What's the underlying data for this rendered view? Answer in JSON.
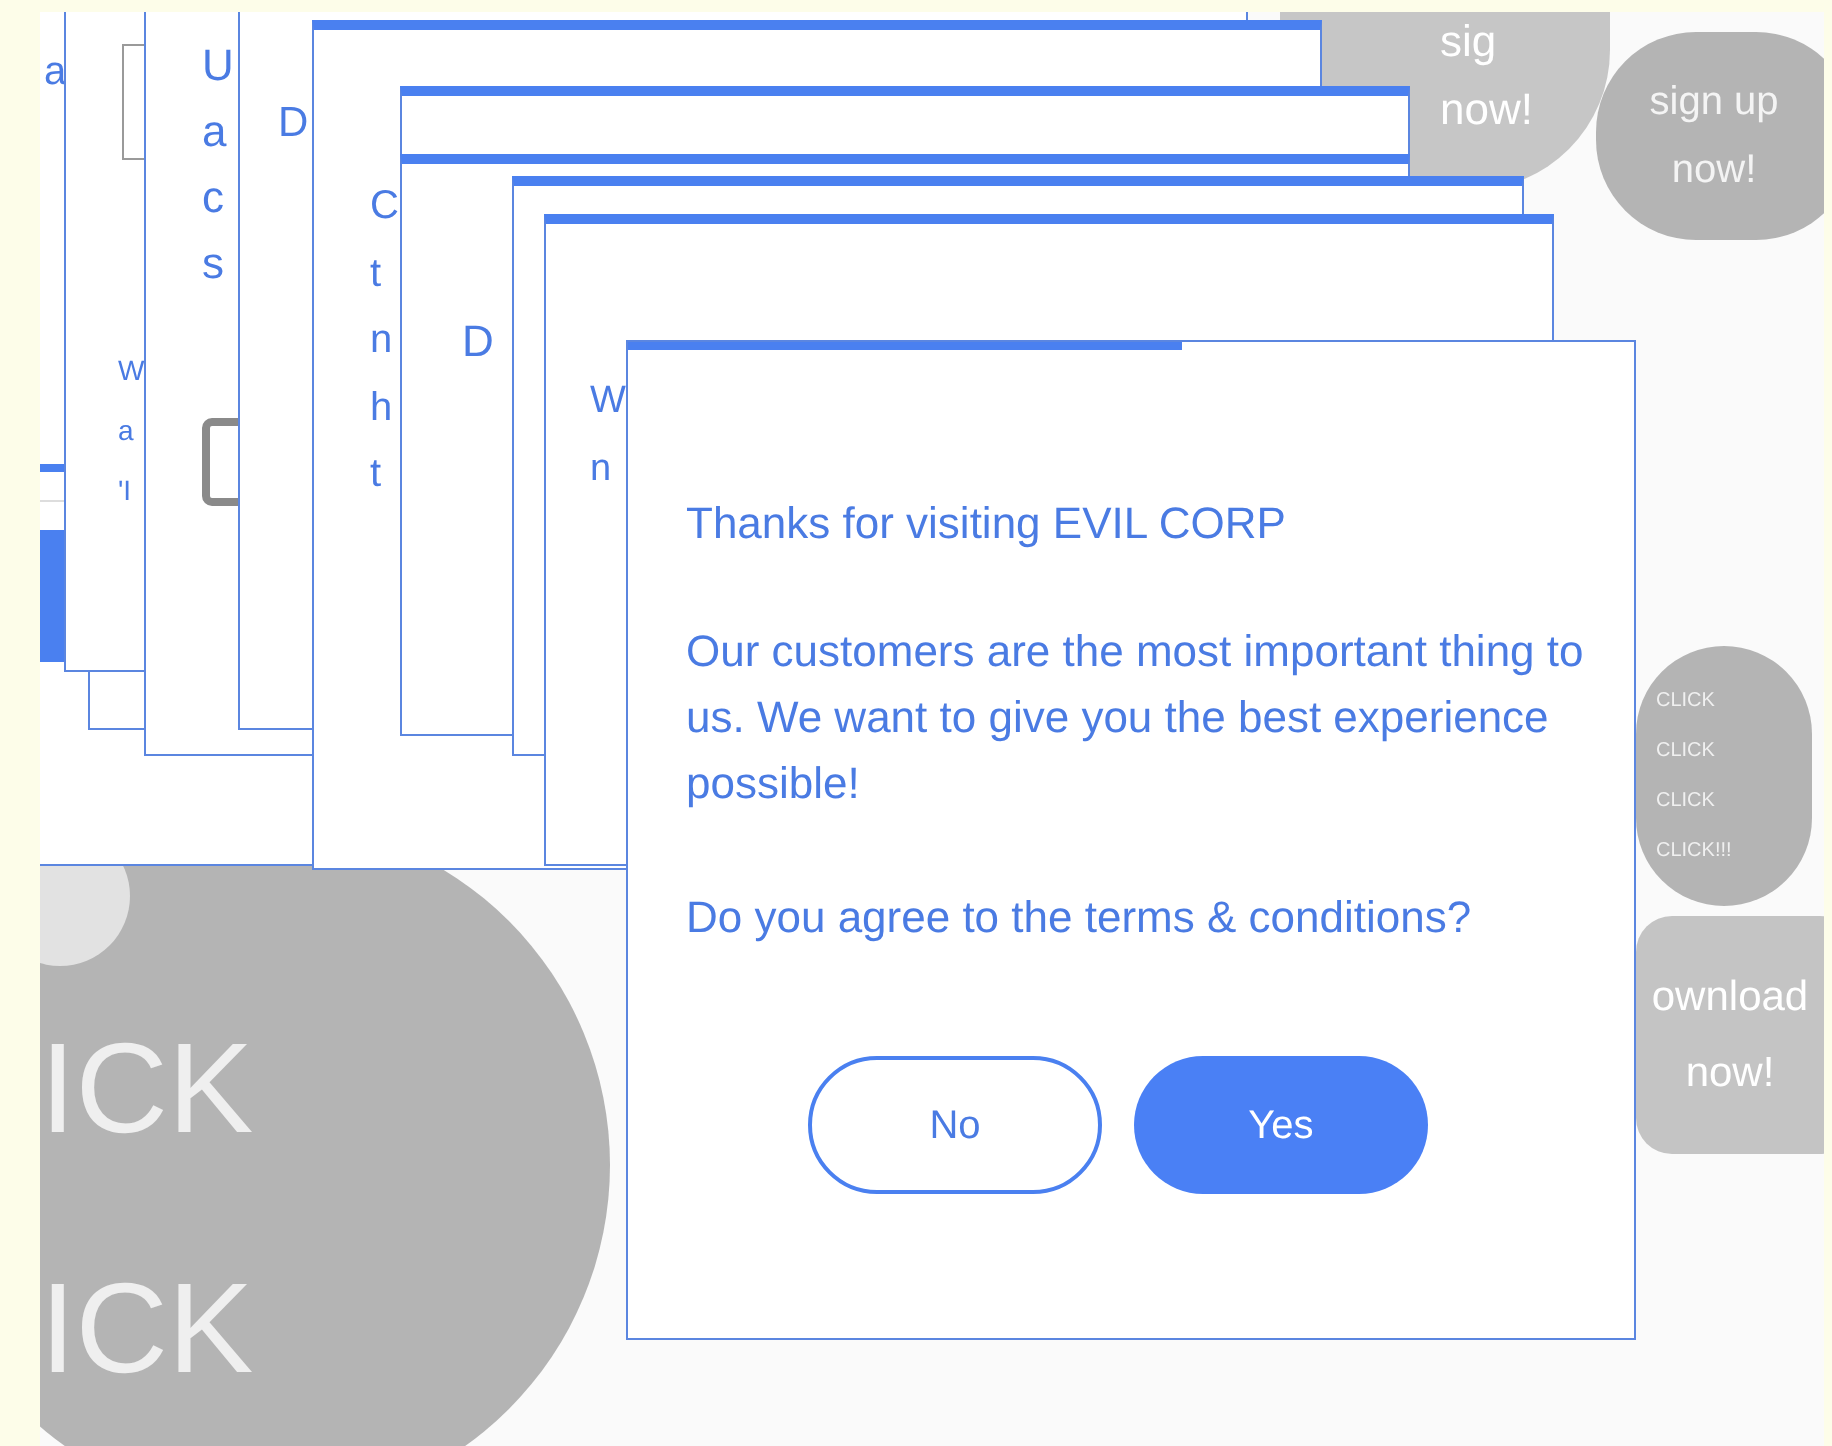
{
  "ads": [
    {
      "kind": "big_circle",
      "lines": [
        "ICK",
        "ICK"
      ]
    },
    {
      "kind": "small_circle"
    },
    {
      "kind": "top_blob",
      "lines": [
        "sig",
        "now!"
      ]
    },
    {
      "kind": "signup_pill",
      "lines": [
        "sign up",
        "now!"
      ]
    },
    {
      "kind": "click_circle",
      "lines": [
        "CLICK",
        "CLICK",
        "CLICK",
        "CLICK!!!"
      ]
    },
    {
      "kind": "download_box",
      "lines": [
        "ownload",
        "now!"
      ]
    }
  ],
  "background_dialogs": [
    {
      "kind": "button",
      "lines": [
        "a"
      ]
    },
    {
      "kind": "blank"
    },
    {
      "kind": "field",
      "lines": [
        "W",
        "a",
        "'I"
      ]
    },
    {
      "kind": "checkbox",
      "checked": false,
      "lines": [
        "U",
        "a",
        "c",
        "s"
      ]
    },
    {
      "kind": "text",
      "lines": [
        "D"
      ]
    },
    {
      "kind": "text",
      "lines": [
        "C",
        "t",
        "n",
        "h",
        "t"
      ]
    },
    {
      "kind": "blank"
    },
    {
      "kind": "text",
      "lines": [
        "D"
      ]
    },
    {
      "kind": "blank"
    },
    {
      "kind": "text",
      "lines": [
        "W",
        "n"
      ]
    }
  ],
  "dialog": {
    "timer_bar": {
      "level": 0.55
    },
    "title": "Thanks for visiting EVIL CORP",
    "message": "Our customers are the most important thing to us. We want to give you the best experience possible!",
    "question": "Do you agree to the terms & conditions?",
    "buttons": [
      {
        "label": "No",
        "kind": "outline"
      },
      {
        "label": "Yes",
        "kind": "filled"
      }
    ]
  }
}
